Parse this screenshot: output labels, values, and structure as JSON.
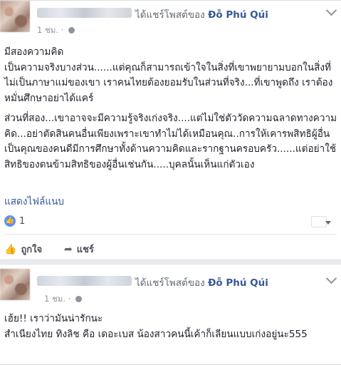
{
  "posts": [
    {
      "header_suffix": "ได้แชร์โพสต์ของ",
      "author": "Đỗ Phú Qúi",
      "time": "1 ชม.",
      "paragraphs": [
        "มีสองความคิด\nเป็นความจริงบางส่วน......แต่คุณก็สามารถเข้าใจในสิ่งที่เขาพยายามบอกในสิ่งที่ไม่เป็นภาษาแม่ของเขา เราคนไทยต้องยอมรับในส่วนที่จริง...ที่เขาพูดถึง เราต้องหมั่นศึกษาอย่าได้แคร์",
        "ส่วนที่สอง...เขาอาจจะมีความรู้จริงเก่งจริง....แต่ไม่ใช่ตัววัดความฉลาดทางความคิด...อย่าตัดสินคนอื่นเพียงเพราะเขาทำไม่ได้เหมือนคุณ..การให้เคารพสิทธิผู้อื่นเป็นคุณของคนดีมีการศึกษาทั้งด้านความคิดและรากฐานครอบครัว......แต่อย่าใช้สิทธิของตนข้ามสิทธิของผู้อื่นเช่นกัน.....บุคลนั้นเห็นแก่ตัวเอง"
      ],
      "attachment_link": "แสดงไฟล์แนบ",
      "like_count": "1",
      "actions": {
        "like": "ถูกใจ",
        "share": "แชร์"
      }
    },
    {
      "header_suffix": "ได้แชร์โพสต์ของ",
      "author": "Đỗ Phú Qúi",
      "time": "1 ชม.",
      "paragraphs": [
        "เฮ้ย!! เราว่ามันน่ารักนะ\nสำเนียงไทย ทิงลิช คือ เดอะเบส น้องสาวคนนี้เค้าก็เลียนแบบเก่งอยู่นะ555"
      ]
    }
  ],
  "icons": {
    "like_badge": "thumbs-up-icon",
    "like_action": "thumbs-up-icon",
    "share_action": "share-arrow-icon",
    "privacy": "globe-icon",
    "menu": "chevron-down-icon"
  },
  "colors": {
    "link": "#365899",
    "like_blue": "#5890ff",
    "meta_gray": "#90949c",
    "background": "#e9ebee"
  }
}
